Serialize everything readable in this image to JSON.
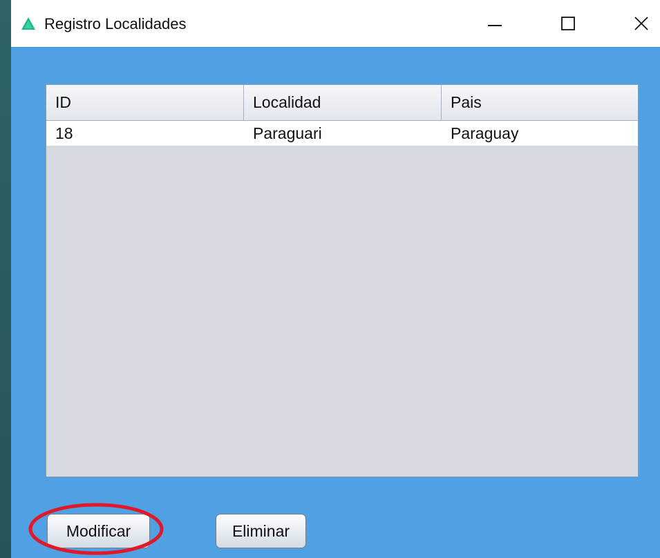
{
  "window": {
    "title": "Registro Localidades",
    "icon": "app-triangle-icon",
    "controls": {
      "minimize": "minimize-icon",
      "maximize": "maximize-icon",
      "close": "close-icon"
    }
  },
  "table": {
    "columns": [
      "ID",
      "Localidad",
      "Pais"
    ],
    "rows": [
      [
        "18",
        "Paraguari",
        "Paraguay"
      ]
    ]
  },
  "buttons": {
    "modify_label": "Modificar",
    "delete_label": "Eliminar"
  },
  "colors": {
    "window_bg": "#4fa1e4",
    "table_empty_bg": "#d6d9e0",
    "highlight": "#e0192a",
    "icon_accent": "#1db98a"
  }
}
